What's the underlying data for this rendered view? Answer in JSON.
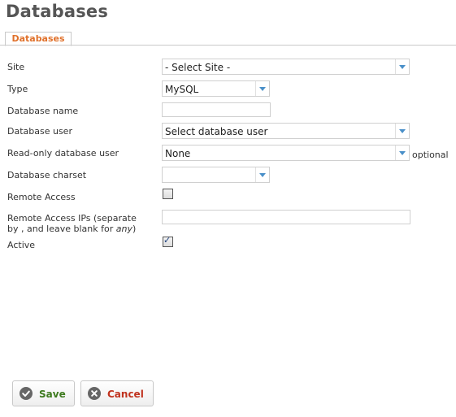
{
  "header": {
    "title": "Databases"
  },
  "tabs": [
    {
      "label": "Databases"
    }
  ],
  "form": {
    "site": {
      "label": "Site",
      "value": "- Select Site -"
    },
    "type": {
      "label": "Type",
      "value": "MySQL"
    },
    "database_name": {
      "label": "Database name",
      "value": ""
    },
    "database_user": {
      "label": "Database user",
      "value": "Select database user"
    },
    "readonly_user": {
      "label": "Read-only database user",
      "value": "None",
      "hint": "optional"
    },
    "charset": {
      "label": "Database charset",
      "value": ""
    },
    "remote_access": {
      "label": "Remote Access",
      "checked": false
    },
    "remote_ips": {
      "label_line1": "Remote Access IPs (separate",
      "label_line2_prefix": "by , and leave blank for ",
      "label_line2_em": "any",
      "label_line2_suffix": ")",
      "value": ""
    },
    "active": {
      "label": "Active",
      "checked": true
    }
  },
  "buttons": {
    "save": "Save",
    "cancel": "Cancel"
  },
  "colors": {
    "accent": "#e0712b",
    "save_green": "#3d7a1e",
    "cancel_red": "#c0321e",
    "arrow_blue": "#4a90c9"
  },
  "icons": {
    "save": "check-circle-icon",
    "cancel": "x-circle-icon",
    "dropdown": "chevron-down-icon"
  }
}
